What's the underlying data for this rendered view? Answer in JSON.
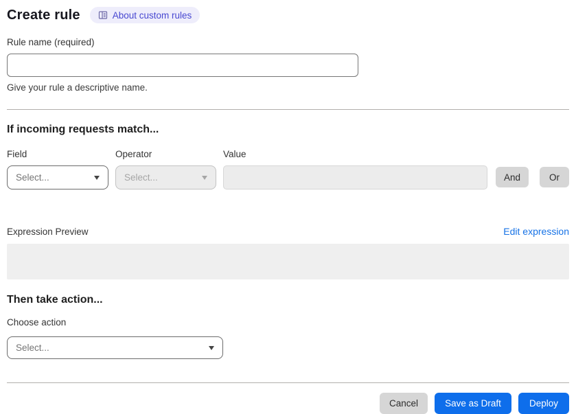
{
  "page": {
    "title": "Create rule",
    "about_link_label": "About custom rules"
  },
  "rule_name": {
    "label": "Rule name (required)",
    "value": "",
    "helper": "Give your rule a descriptive name."
  },
  "match_section": {
    "heading": "If incoming requests match...",
    "field": {
      "label": "Field",
      "selected": "Select..."
    },
    "operator": {
      "label": "Operator",
      "selected": "Select...",
      "disabled": true
    },
    "value": {
      "label": "Value",
      "value": "",
      "disabled": true
    },
    "and_label": "And",
    "or_label": "Or",
    "expression_preview_label": "Expression Preview",
    "edit_expression_label": "Edit expression",
    "expression_value": ""
  },
  "action_section": {
    "heading": "Then take action...",
    "choose_action_label": "Choose action",
    "selected": "Select..."
  },
  "footer": {
    "cancel_label": "Cancel",
    "save_draft_label": "Save as Draft",
    "deploy_label": "Deploy"
  },
  "icons": {
    "badge": "book-icon",
    "selects": "caret-down-icon"
  },
  "colors": {
    "primary_blue": "#0e6eeb",
    "link_blue": "#1672e6",
    "badge_bg": "#eeedfb",
    "badge_text": "#4747d1",
    "divider_gray": "#b1afac",
    "disabled_bg": "#ececec",
    "button_gray": "#d6d6d6"
  }
}
